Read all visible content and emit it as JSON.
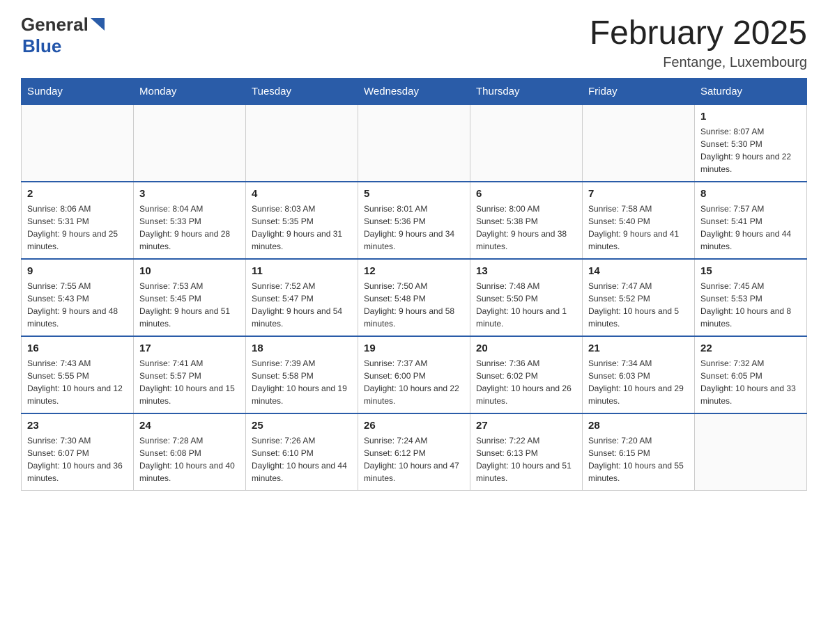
{
  "header": {
    "logo": {
      "general": "General",
      "blue": "Blue",
      "arrow_char": "▶"
    },
    "title": "February 2025",
    "subtitle": "Fentange, Luxembourg"
  },
  "calendar": {
    "days_of_week": [
      "Sunday",
      "Monday",
      "Tuesday",
      "Wednesday",
      "Thursday",
      "Friday",
      "Saturday"
    ],
    "weeks": [
      [
        {
          "day": "",
          "info": ""
        },
        {
          "day": "",
          "info": ""
        },
        {
          "day": "",
          "info": ""
        },
        {
          "day": "",
          "info": ""
        },
        {
          "day": "",
          "info": ""
        },
        {
          "day": "",
          "info": ""
        },
        {
          "day": "1",
          "info": "Sunrise: 8:07 AM\nSunset: 5:30 PM\nDaylight: 9 hours and 22 minutes."
        }
      ],
      [
        {
          "day": "2",
          "info": "Sunrise: 8:06 AM\nSunset: 5:31 PM\nDaylight: 9 hours and 25 minutes."
        },
        {
          "day": "3",
          "info": "Sunrise: 8:04 AM\nSunset: 5:33 PM\nDaylight: 9 hours and 28 minutes."
        },
        {
          "day": "4",
          "info": "Sunrise: 8:03 AM\nSunset: 5:35 PM\nDaylight: 9 hours and 31 minutes."
        },
        {
          "day": "5",
          "info": "Sunrise: 8:01 AM\nSunset: 5:36 PM\nDaylight: 9 hours and 34 minutes."
        },
        {
          "day": "6",
          "info": "Sunrise: 8:00 AM\nSunset: 5:38 PM\nDaylight: 9 hours and 38 minutes."
        },
        {
          "day": "7",
          "info": "Sunrise: 7:58 AM\nSunset: 5:40 PM\nDaylight: 9 hours and 41 minutes."
        },
        {
          "day": "8",
          "info": "Sunrise: 7:57 AM\nSunset: 5:41 PM\nDaylight: 9 hours and 44 minutes."
        }
      ],
      [
        {
          "day": "9",
          "info": "Sunrise: 7:55 AM\nSunset: 5:43 PM\nDaylight: 9 hours and 48 minutes."
        },
        {
          "day": "10",
          "info": "Sunrise: 7:53 AM\nSunset: 5:45 PM\nDaylight: 9 hours and 51 minutes."
        },
        {
          "day": "11",
          "info": "Sunrise: 7:52 AM\nSunset: 5:47 PM\nDaylight: 9 hours and 54 minutes."
        },
        {
          "day": "12",
          "info": "Sunrise: 7:50 AM\nSunset: 5:48 PM\nDaylight: 9 hours and 58 minutes."
        },
        {
          "day": "13",
          "info": "Sunrise: 7:48 AM\nSunset: 5:50 PM\nDaylight: 10 hours and 1 minute."
        },
        {
          "day": "14",
          "info": "Sunrise: 7:47 AM\nSunset: 5:52 PM\nDaylight: 10 hours and 5 minutes."
        },
        {
          "day": "15",
          "info": "Sunrise: 7:45 AM\nSunset: 5:53 PM\nDaylight: 10 hours and 8 minutes."
        }
      ],
      [
        {
          "day": "16",
          "info": "Sunrise: 7:43 AM\nSunset: 5:55 PM\nDaylight: 10 hours and 12 minutes."
        },
        {
          "day": "17",
          "info": "Sunrise: 7:41 AM\nSunset: 5:57 PM\nDaylight: 10 hours and 15 minutes."
        },
        {
          "day": "18",
          "info": "Sunrise: 7:39 AM\nSunset: 5:58 PM\nDaylight: 10 hours and 19 minutes."
        },
        {
          "day": "19",
          "info": "Sunrise: 7:37 AM\nSunset: 6:00 PM\nDaylight: 10 hours and 22 minutes."
        },
        {
          "day": "20",
          "info": "Sunrise: 7:36 AM\nSunset: 6:02 PM\nDaylight: 10 hours and 26 minutes."
        },
        {
          "day": "21",
          "info": "Sunrise: 7:34 AM\nSunset: 6:03 PM\nDaylight: 10 hours and 29 minutes."
        },
        {
          "day": "22",
          "info": "Sunrise: 7:32 AM\nSunset: 6:05 PM\nDaylight: 10 hours and 33 minutes."
        }
      ],
      [
        {
          "day": "23",
          "info": "Sunrise: 7:30 AM\nSunset: 6:07 PM\nDaylight: 10 hours and 36 minutes."
        },
        {
          "day": "24",
          "info": "Sunrise: 7:28 AM\nSunset: 6:08 PM\nDaylight: 10 hours and 40 minutes."
        },
        {
          "day": "25",
          "info": "Sunrise: 7:26 AM\nSunset: 6:10 PM\nDaylight: 10 hours and 44 minutes."
        },
        {
          "day": "26",
          "info": "Sunrise: 7:24 AM\nSunset: 6:12 PM\nDaylight: 10 hours and 47 minutes."
        },
        {
          "day": "27",
          "info": "Sunrise: 7:22 AM\nSunset: 6:13 PM\nDaylight: 10 hours and 51 minutes."
        },
        {
          "day": "28",
          "info": "Sunrise: 7:20 AM\nSunset: 6:15 PM\nDaylight: 10 hours and 55 minutes."
        },
        {
          "day": "",
          "info": ""
        }
      ]
    ]
  }
}
